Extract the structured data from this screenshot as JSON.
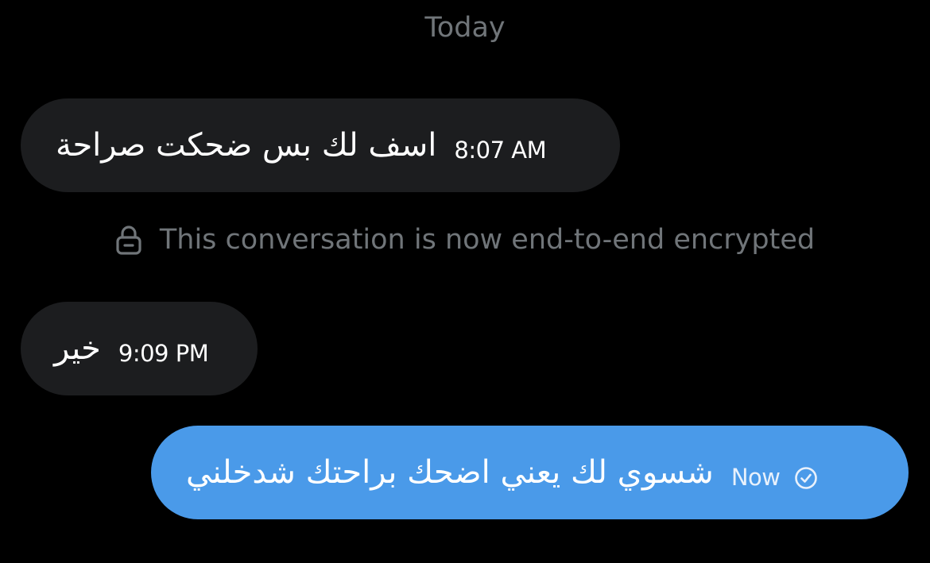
{
  "date_separator": "Today",
  "encryption_notice": "This conversation is now end-to-end encrypted",
  "messages": [
    {
      "direction": "incoming",
      "text": "اسف لك بس ضحكت صراحة",
      "time": "8:07 AM"
    },
    {
      "direction": "incoming",
      "text": "خير",
      "time": "9:09 PM"
    },
    {
      "direction": "outgoing",
      "text": "شسوي لك يعني اضحك براحتك شدخلني",
      "time": "Now",
      "status_icon": "sent-check-icon"
    }
  ],
  "colors": {
    "background": "#000000",
    "incoming_bubble": "#1c1d1f",
    "outgoing_bubble": "#4a9ae9",
    "muted_text": "#707579"
  }
}
